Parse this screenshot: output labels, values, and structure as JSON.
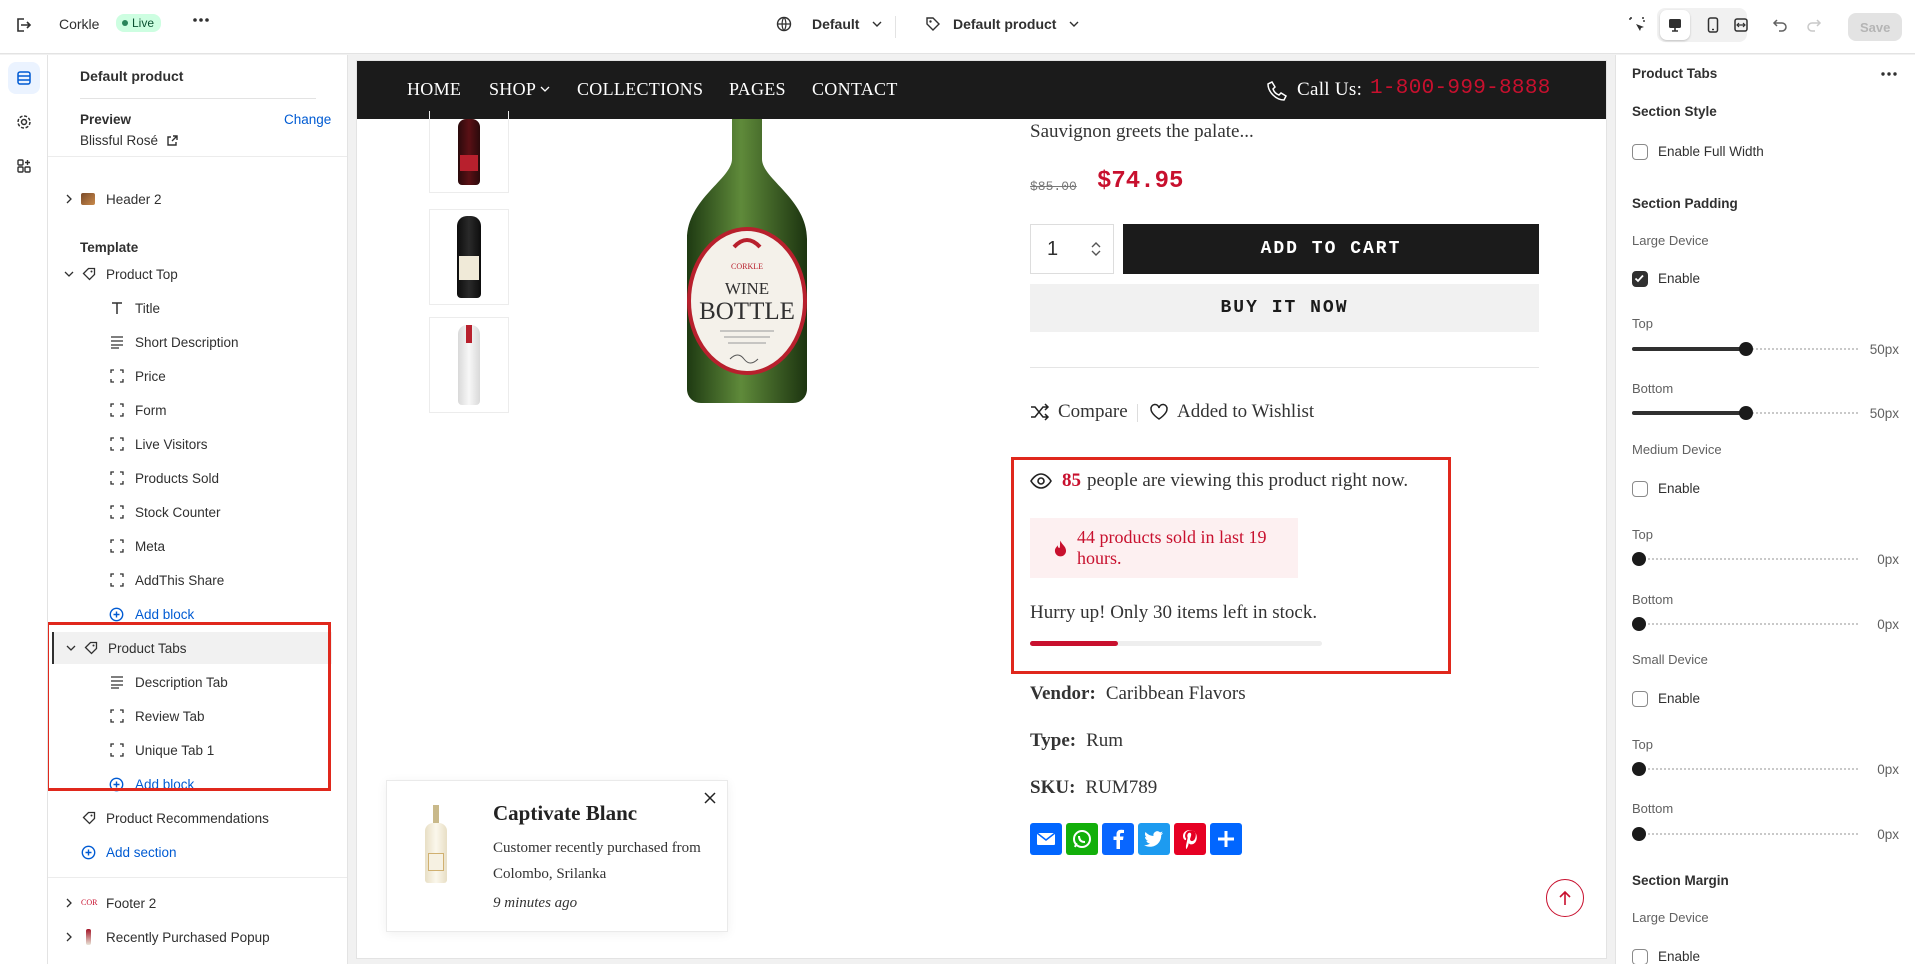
{
  "topbar": {
    "store": "Corkle",
    "status": "Live",
    "theme": "Default",
    "template": "Default product",
    "save": "Save"
  },
  "sidebar": {
    "title": "Default product",
    "preview_label": "Preview",
    "preview_change": "Change",
    "preview_product": "Blissful Rosé",
    "header": "Header 2",
    "template_label": "Template",
    "product_top": "Product Top",
    "top_blocks": [
      "Title",
      "Short Description",
      "Price",
      "Form",
      "Live Visitors",
      "Products Sold",
      "Stock Counter",
      "Meta",
      "AddThis Share"
    ],
    "add_block": "Add block",
    "product_tabs": "Product Tabs",
    "tab_blocks": [
      "Description Tab",
      "Review Tab",
      "Unique Tab 1"
    ],
    "product_recommendations": "Product Recommendations",
    "add_section": "Add section",
    "footer": "Footer 2",
    "recent_popup": "Recently Purchased Popup"
  },
  "store_nav": {
    "items": [
      "HOME",
      "SHOP",
      "COLLECTIONS",
      "PAGES",
      "CONTACT"
    ],
    "call_label": "Call Us:",
    "phone": "1-800-999-8888"
  },
  "product": {
    "desc_tail": "Sauvignon greets the palate...",
    "old_price": "$85.00",
    "price": "$74.95",
    "qty": "1",
    "add_to_cart": "ADD TO CART",
    "buy_now": "BUY IT NOW",
    "compare": "Compare",
    "wishlist": "Added to Wishlist",
    "viewers_count": "85",
    "viewers_text": "people are viewing this product right now.",
    "sold_text": "44 products sold in last 19 hours.",
    "stock_text": "Hurry up! Only 30 items left in stock.",
    "stock_level": 0.3,
    "vendor_label": "Vendor:",
    "vendor": "Caribbean Flavors",
    "type_label": "Type:",
    "type": "Rum",
    "sku_label": "SKU:",
    "sku": "RUM789",
    "label_brand": "CORKLE",
    "label_line1": "WINE",
    "label_line2": "BOTTLE"
  },
  "popup": {
    "title": "Captivate Blanc",
    "text": "Customer recently purchased from Colombo, Srilanka",
    "time": "9 minutes ago"
  },
  "colors": {
    "accent": "#c8102e",
    "highlight": "#e0281c",
    "nav_bg": "#1b1b1b"
  },
  "panel": {
    "title": "Product Tabs",
    "section_style": "Section Style",
    "full_width": "Enable Full Width",
    "section_padding": "Section Padding",
    "large_device": "Large Device",
    "enable": "Enable",
    "top": "Top",
    "bottom": "Bottom",
    "large_top_value": "50px",
    "large_bottom_value": "50px",
    "medium_device": "Medium Device",
    "medium_top_value": "0px",
    "medium_bottom_value": "0px",
    "small_device": "Small Device",
    "small_top_value": "0px",
    "small_bottom_value": "0px",
    "section_margin": "Section Margin",
    "margin_large_device": "Large Device",
    "margin_enable": "Enable"
  }
}
